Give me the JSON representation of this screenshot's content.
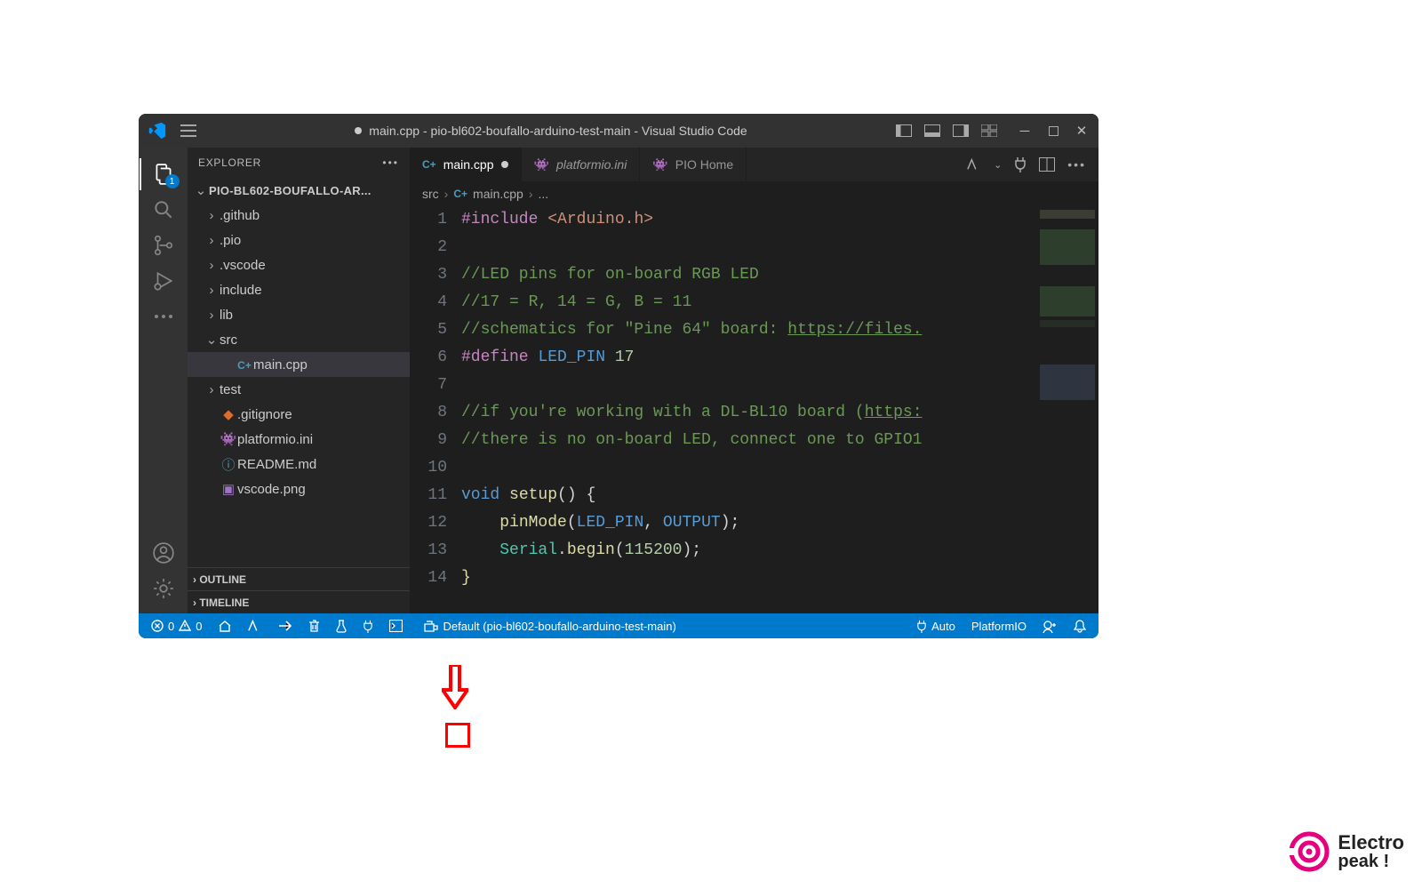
{
  "window": {
    "title": "main.cpp - pio-bl602-boufallo-arduino-test-main - Visual Studio Code",
    "modified": true
  },
  "activitybar": {
    "items": [
      {
        "name": "explorer",
        "icon": "files-icon",
        "active": true,
        "badge": "1"
      },
      {
        "name": "search",
        "icon": "search-icon"
      },
      {
        "name": "scm",
        "icon": "branch-icon"
      },
      {
        "name": "run",
        "icon": "play-bug-icon"
      },
      {
        "name": "more",
        "icon": "ellipsis-icon"
      }
    ],
    "bottom": [
      {
        "name": "accounts",
        "icon": "account-icon"
      },
      {
        "name": "settings",
        "icon": "gear-icon"
      }
    ]
  },
  "sidebar": {
    "title": "EXPLORER",
    "project": "PIO-BL602-BOUFALLO-AR...",
    "tree": [
      {
        "type": "folder",
        "name": ".github",
        "expanded": false,
        "depth": 1
      },
      {
        "type": "folder",
        "name": ".pio",
        "expanded": false,
        "depth": 1
      },
      {
        "type": "folder",
        "name": ".vscode",
        "expanded": false,
        "depth": 1
      },
      {
        "type": "folder",
        "name": "include",
        "expanded": false,
        "depth": 1
      },
      {
        "type": "folder",
        "name": "lib",
        "expanded": false,
        "depth": 1
      },
      {
        "type": "folder",
        "name": "src",
        "expanded": true,
        "depth": 1
      },
      {
        "type": "file",
        "name": "main.cpp",
        "icon": "cpp",
        "depth": 2,
        "selected": true
      },
      {
        "type": "folder",
        "name": "test",
        "expanded": false,
        "depth": 1
      },
      {
        "type": "file",
        "name": ".gitignore",
        "icon": "git",
        "depth": 1
      },
      {
        "type": "file",
        "name": "platformio.ini",
        "icon": "pio",
        "depth": 1
      },
      {
        "type": "file",
        "name": "README.md",
        "icon": "info",
        "depth": 1
      },
      {
        "type": "file",
        "name": "vscode.png",
        "icon": "img",
        "depth": 1
      }
    ],
    "sections": [
      "OUTLINE",
      "TIMELINE"
    ]
  },
  "tabs": [
    {
      "label": "main.cpp",
      "icon": "cpp",
      "active": true,
      "modified": true
    },
    {
      "label": "platformio.ini",
      "icon": "pio",
      "active": false,
      "italic": true
    },
    {
      "label": "PIO Home",
      "icon": "pio",
      "active": false
    }
  ],
  "breadcrumb": {
    "seg1": "src",
    "seg2": "main.cpp",
    "seg3": "..."
  },
  "code": {
    "lines": [
      {
        "n": 1,
        "html": "<span class='tok-pp'>#include</span> <span class='tok-str'>&lt;Arduino.h&gt;</span>"
      },
      {
        "n": 2,
        "html": ""
      },
      {
        "n": 3,
        "html": "<span class='tok-cmt'>//LED pins for on-board RGB LED</span>"
      },
      {
        "n": 4,
        "html": "<span class='tok-cmt'>//17 = R, 14 = G, B = 11</span>"
      },
      {
        "n": 5,
        "html": "<span class='tok-cmt'>//schematics for \"Pine 64\" board: <span class='underline'>https://files.</span></span>"
      },
      {
        "n": 6,
        "html": "<span class='tok-pp'>#define</span> <span class='tok-inc'>LED_PIN</span> <span class='tok-num'>17</span>"
      },
      {
        "n": 7,
        "html": ""
      },
      {
        "n": 8,
        "html": "<span class='tok-cmt'>//if you're working with a DL-BL10 board (<span class='underline'>https:</span></span>"
      },
      {
        "n": 9,
        "html": "<span class='tok-cmt'>//there is no on-board LED, connect one to GPIO1</span>"
      },
      {
        "n": 10,
        "html": ""
      },
      {
        "n": 11,
        "html": "<span class='tok-kw'>void</span> <span class='tok-fn'>setup</span>() {"
      },
      {
        "n": 12,
        "html": "    <span class='tok-fn'>pinMode</span>(<span class='tok-mac'>LED_PIN</span>, <span class='tok-mac'>OUTPUT</span>);"
      },
      {
        "n": 13,
        "html": "    <span class='tok-typ'>Serial</span>.<span class='tok-fn'>begin</span>(<span class='tok-num'>115200</span>);"
      },
      {
        "n": 14,
        "html": "<span class='tok-fn'>}</span>"
      }
    ]
  },
  "statusbar": {
    "errors": "0",
    "warnings": "0",
    "env": "Default (pio-bl602-boufallo-arduino-test-main)",
    "port": "Auto",
    "platformio": "PlatformIO"
  },
  "brand": {
    "line1": "Electro",
    "line2": "peak !"
  }
}
